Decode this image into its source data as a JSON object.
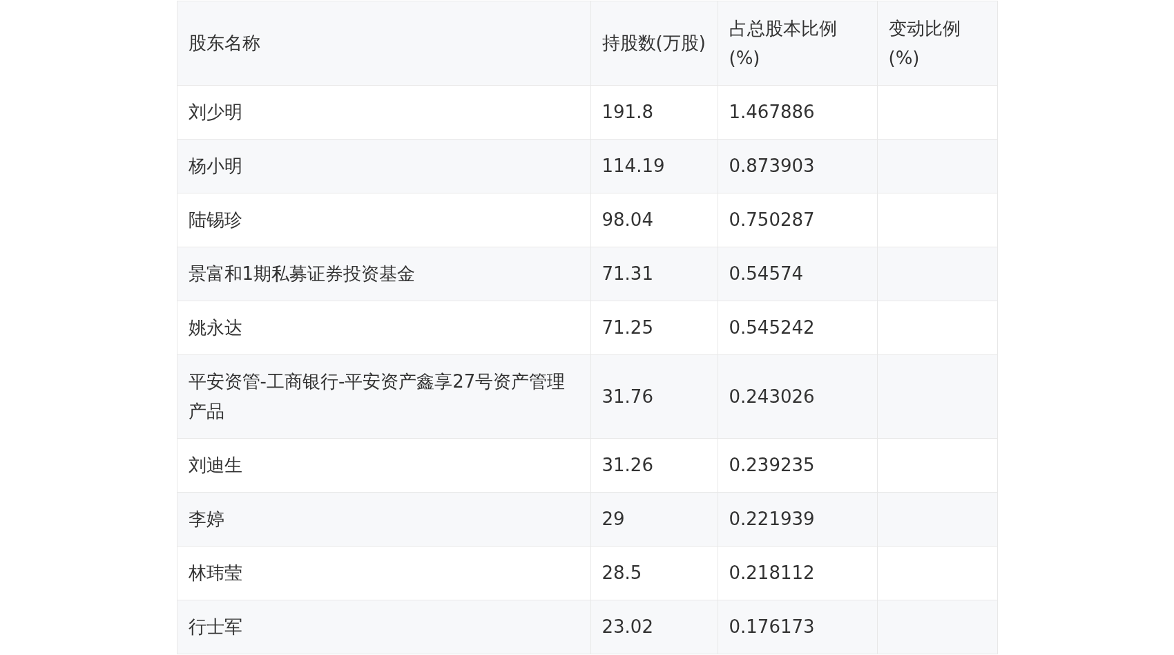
{
  "table": {
    "columns": [
      "股东名称",
      "持股数(万股)",
      "占总股本比例(%)",
      "变动比例(%)"
    ],
    "rows": [
      [
        "刘少明",
        "191.8",
        "1.467886"
      ],
      [
        "杨小明",
        "114.19",
        "0.873903"
      ],
      [
        "陆锡珍",
        "98.04",
        "0.750287"
      ],
      [
        "景富和1期私募证券投资基金",
        "71.31",
        "0.54574"
      ],
      [
        "姚永达",
        "71.25",
        "0.545242"
      ],
      [
        "平安资管-工商银行-平安资产鑫享27号资产管理产品",
        "31.76",
        "0.243026"
      ],
      [
        "刘迪生",
        "31.26",
        "0.239235"
      ],
      [
        "李婷",
        "29",
        "0.221939"
      ],
      [
        "林玮莹",
        "28.5",
        "0.218112"
      ],
      [
        "行士军",
        "23.02",
        "0.176173"
      ]
    ]
  }
}
